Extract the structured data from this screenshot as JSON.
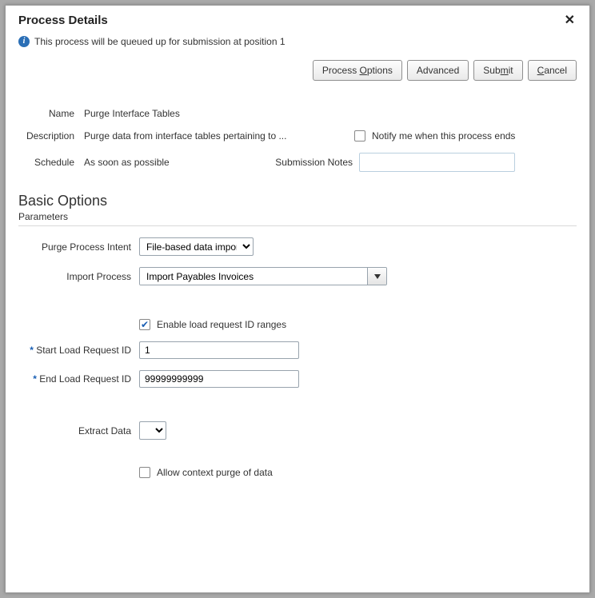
{
  "title": "Process Details",
  "info_message": "This process will be queued up for submission at position 1",
  "buttons": {
    "process_options_pre": "Process ",
    "process_options_m": "O",
    "process_options_post": "ptions",
    "advanced": "Advanced",
    "submit_pre": "Sub",
    "submit_m": "m",
    "submit_post": "it",
    "cancel_m": "C",
    "cancel_post": "ancel"
  },
  "details": {
    "name_label": "Name",
    "name_value": "Purge Interface Tables",
    "description_label": "Description",
    "description_value": "Purge data from interface tables pertaining to ...",
    "schedule_label": "Schedule",
    "schedule_value": "As soon as possible",
    "notify_label": "Notify me when this process ends",
    "notify_checked": false,
    "submission_notes_label": "Submission Notes",
    "submission_notes_value": ""
  },
  "section": {
    "title": "Basic Options",
    "subtitle": "Parameters"
  },
  "params": {
    "purge_intent_label": "Purge Process Intent",
    "purge_intent_value": "File-based data import",
    "import_process_label": "Import Process",
    "import_process_value": "Import Payables Invoices",
    "enable_ranges_label": "Enable load request ID ranges",
    "enable_ranges_checked": true,
    "start_id_label": "Start Load Request ID",
    "start_id_value": "1",
    "end_id_label": "End Load Request ID",
    "end_id_value": "99999999999",
    "extract_data_label": "Extract Data",
    "extract_data_value": "",
    "allow_context_label": "Allow context purge of data",
    "allow_context_checked": false
  }
}
